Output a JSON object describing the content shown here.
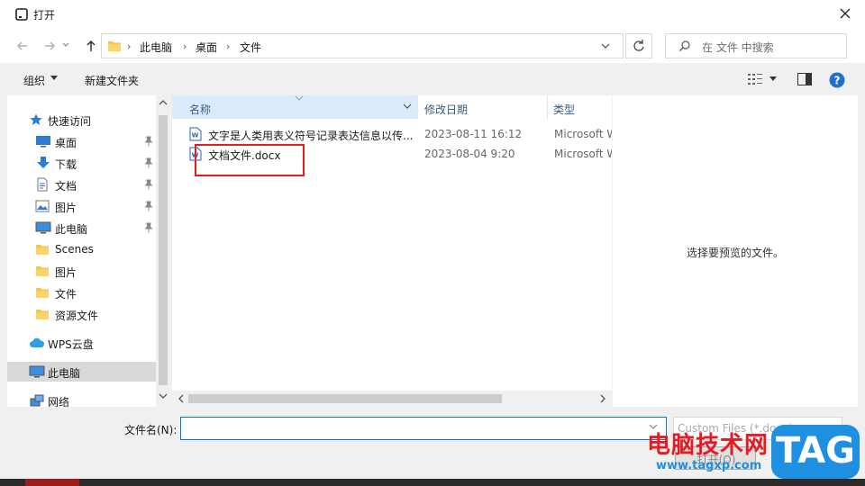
{
  "window": {
    "title": "打开"
  },
  "address": {
    "breadcrumbs": [
      "此电脑",
      "桌面",
      "文件"
    ],
    "search_placeholder": "在 文件 中搜索"
  },
  "toolbar": {
    "organize_label": "组织",
    "new_folder_label": "新建文件夹"
  },
  "nav": {
    "items": [
      {
        "label": "快速访问",
        "icon": "star-icon",
        "pinned": false
      },
      {
        "label": "桌面",
        "icon": "desktop-icon",
        "pinned": true
      },
      {
        "label": "下载",
        "icon": "download-icon",
        "pinned": true
      },
      {
        "label": "文档",
        "icon": "document-icon",
        "pinned": true
      },
      {
        "label": "图片",
        "icon": "picture-icon",
        "pinned": true
      },
      {
        "label": "此电脑",
        "icon": "computer-icon",
        "pinned": true
      },
      {
        "label": "Scenes",
        "icon": "folder-icon",
        "pinned": false
      },
      {
        "label": "图片",
        "icon": "folder-icon",
        "pinned": false
      },
      {
        "label": "文件",
        "icon": "folder-icon",
        "pinned": false
      },
      {
        "label": "资源文件",
        "icon": "folder-icon",
        "pinned": false
      },
      {
        "label": "WPS云盘",
        "icon": "cloud-icon",
        "pinned": false
      },
      {
        "label": "此电脑",
        "icon": "computer-icon",
        "pinned": false,
        "selected": true
      },
      {
        "label": "网络",
        "icon": "network-icon",
        "pinned": false
      }
    ]
  },
  "columns": {
    "name": "名称",
    "date": "修改日期",
    "type": "类型"
  },
  "files": [
    {
      "name": "文字是人类用表义符号记录表达信息以传...",
      "date": "2023-08-11 16:12",
      "type": "Microsoft W"
    },
    {
      "name": "文档文件.docx",
      "date": "2023-08-04 9:20",
      "type": "Microsoft W"
    }
  ],
  "preview": {
    "message": "选择要预览的文件。"
  },
  "bottom": {
    "filename_label": "文件名(N):",
    "filename_value": "",
    "filetype_value": "Custom Files (*.docx)",
    "open_label": "打开(O)"
  },
  "watermark": {
    "text": "电脑技术网",
    "url": "www.tagxp.com",
    "tag": "TAG"
  },
  "colors": {
    "accent": "#0078d7",
    "highlight_box": "#e02020",
    "header_selected": "#dcebfc",
    "selected_nav": "#d9d9d9"
  }
}
